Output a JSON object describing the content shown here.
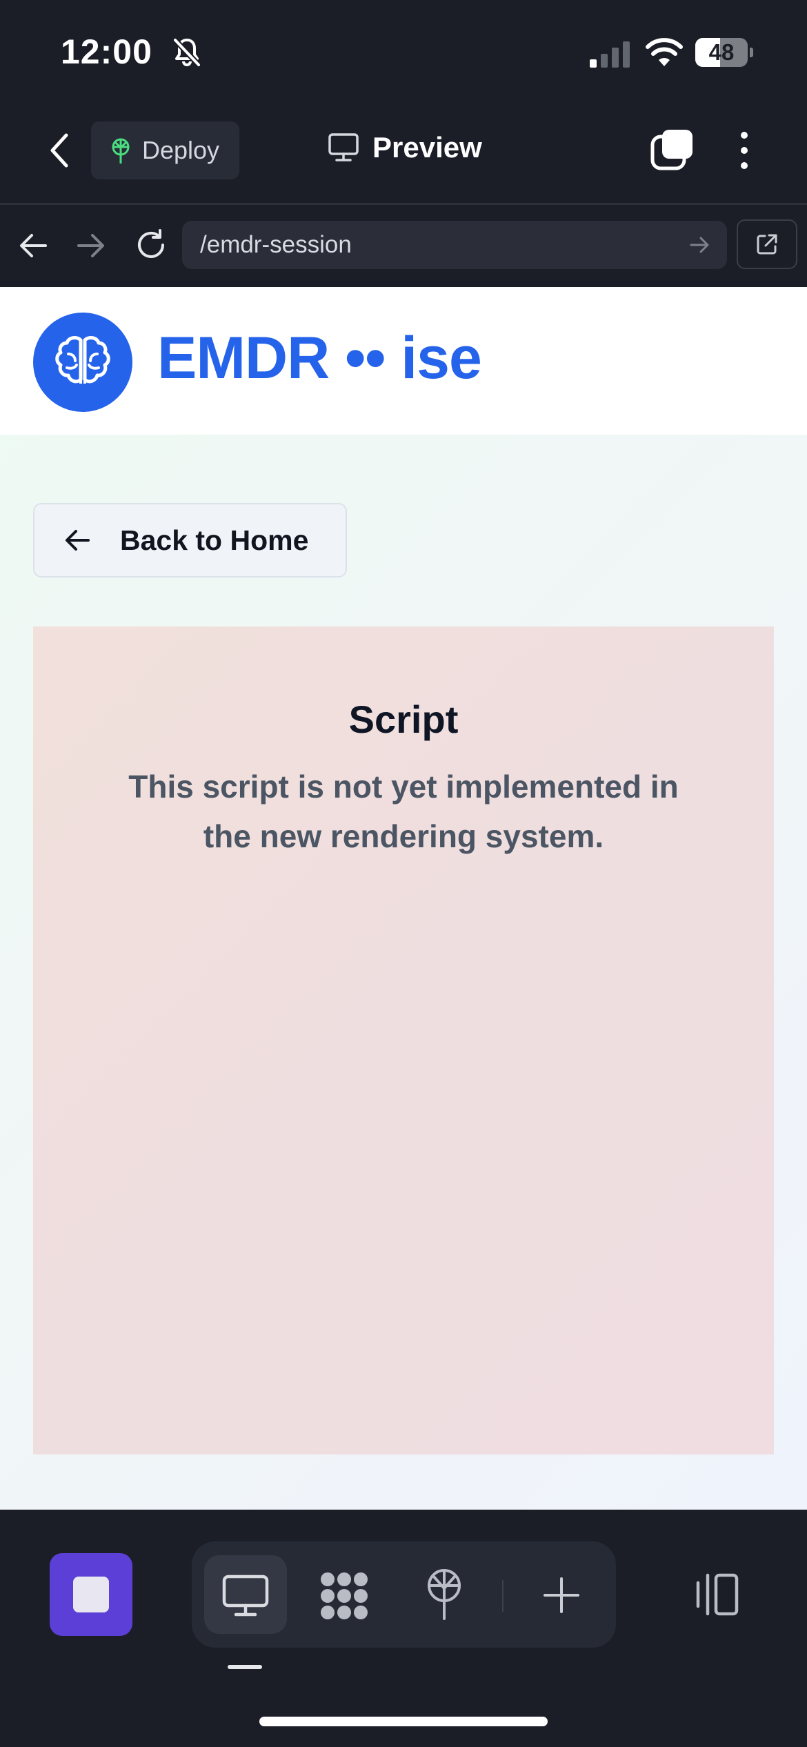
{
  "status_bar": {
    "time": "12:00",
    "battery_level": "48",
    "battery_fraction": 0.48,
    "icons": [
      "bell-slash-icon",
      "cellular-signal-icon",
      "wifi-icon",
      "battery-icon"
    ]
  },
  "top_bar": {
    "deploy_label": "Deploy",
    "preview_label": "Preview",
    "icons": [
      "chevron-left-icon",
      "deploy-tree-icon",
      "monitor-icon",
      "tabs-icon",
      "more-vertical-icon"
    ]
  },
  "url_bar": {
    "url": "/emdr-session",
    "icons": [
      "arrow-left-icon",
      "arrow-right-icon",
      "reload-icon",
      "go-arrow-icon",
      "external-link-icon"
    ]
  },
  "site": {
    "title": "EMDR •• ise",
    "logo_icon": "brain-icon",
    "back_label": "Back to Home",
    "card": {
      "title": "Script",
      "message": "This script is not yet implemented in the new rendering system."
    }
  },
  "colors": {
    "brand_blue": "#2563eb",
    "chrome_dark": "#1b1e27",
    "accent_purple": "#5b3fd6"
  },
  "bottom_toolbar": {
    "icons": [
      "stop-icon",
      "monitor-icon",
      "dots-grid-icon",
      "deploy-tree-icon",
      "plus-icon",
      "panels-icon"
    ]
  }
}
